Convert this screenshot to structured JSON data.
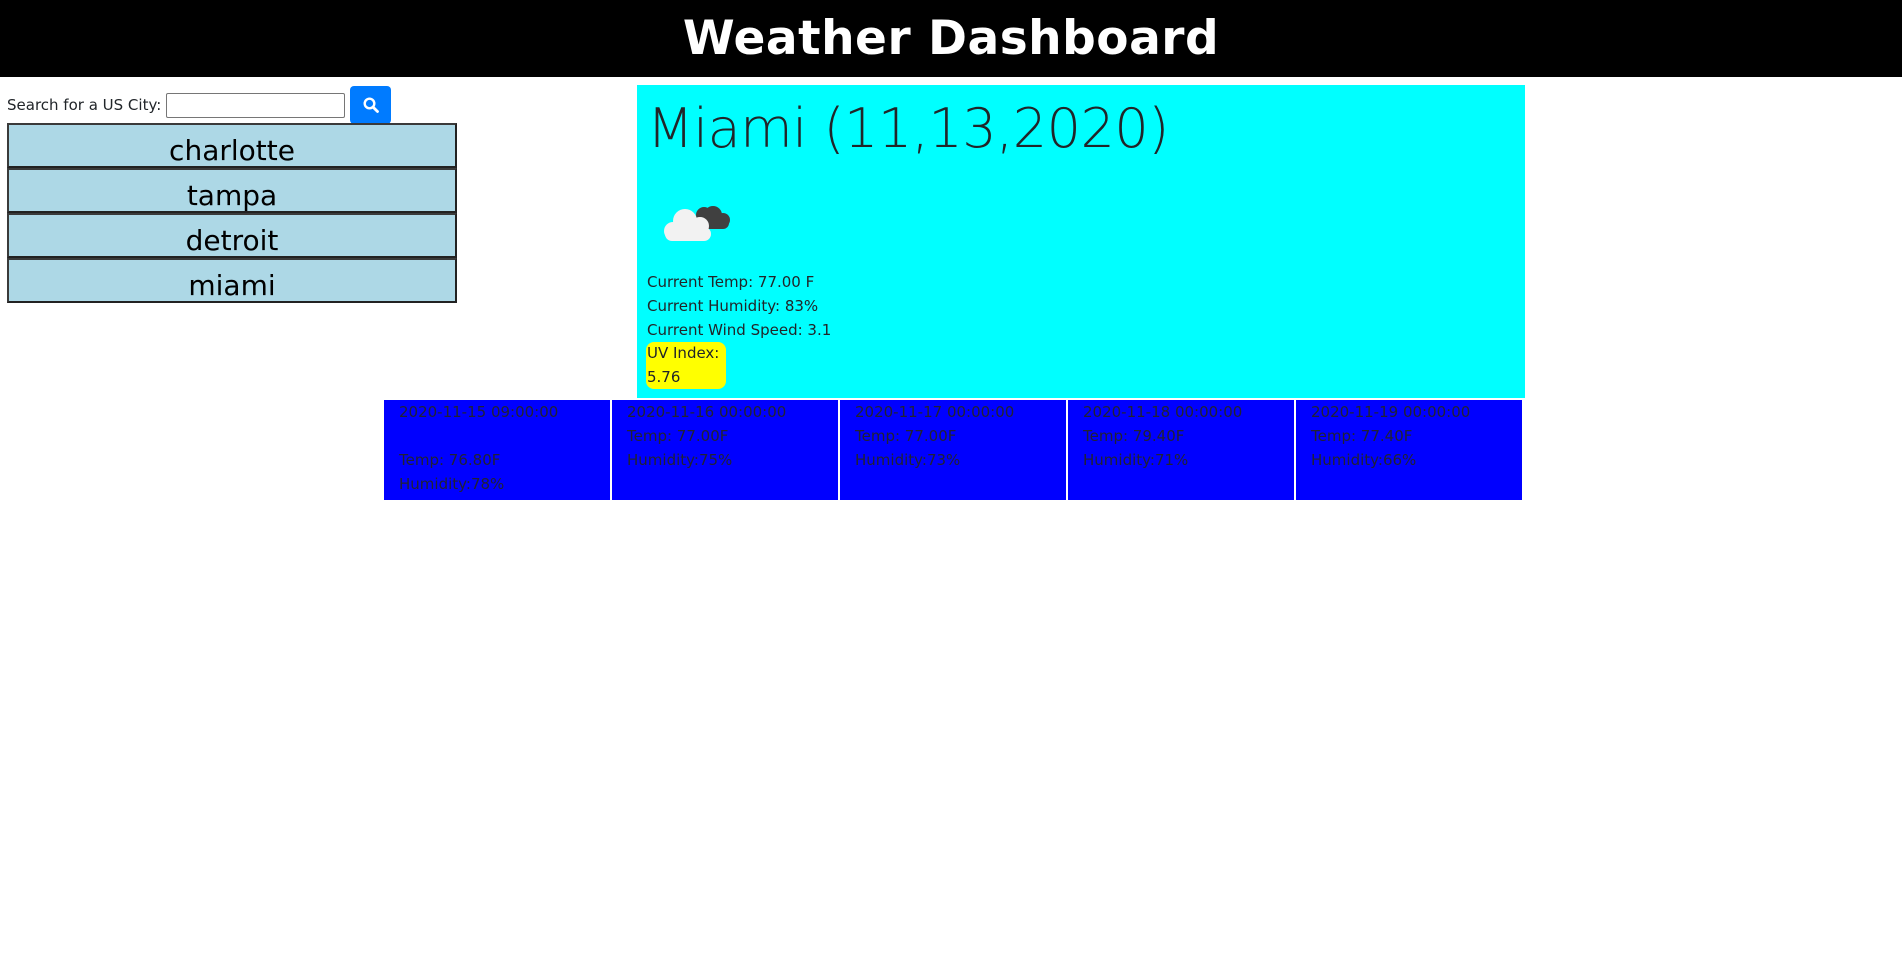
{
  "header": {
    "title": "Weather Dashboard"
  },
  "search": {
    "label": "Search for a US City:",
    "value": "",
    "placeholder": "",
    "button_icon": "search-icon"
  },
  "cities": [
    {
      "label": "charlotte"
    },
    {
      "label": "tampa"
    },
    {
      "label": "detroit"
    },
    {
      "label": "miami"
    }
  ],
  "current": {
    "city_line": "Miami (11,13,2020)",
    "icon": "cloudy-icon",
    "temp": "Current Temp: 77.00 F",
    "humidity": "Current Humidity: 83%",
    "wind": "Current Wind Speed: 3.1",
    "uv_label": "UV Index:",
    "uv_value": "5.76"
  },
  "forecast": [
    {
      "date": "2020-11-15 09:00:00",
      "temp": "Temp: 76.80F",
      "humidity": "Humidity:78%"
    },
    {
      "date": "2020-11-16 00:00:00",
      "temp": "Temp: 77.00F",
      "humidity": "Humidity:75%"
    },
    {
      "date": "2020-11-17 00:00:00",
      "temp": "Temp: 77.00F",
      "humidity": "Humidity:73%"
    },
    {
      "date": "2020-11-18 00:00:00",
      "temp": "Temp: 79.40F",
      "humidity": "Humidity:71%"
    },
    {
      "date": "2020-11-19 00:00:00",
      "temp": "Temp: 77.40F",
      "humidity": "Humidity:66%"
    }
  ],
  "colors": {
    "header_bg": "#000000",
    "search_button": "#007bff",
    "city_button_bg": "#add8e6",
    "current_panel_bg": "#00ffff",
    "uv_badge_bg": "#ffff00",
    "forecast_card_bg": "#0000ff"
  }
}
